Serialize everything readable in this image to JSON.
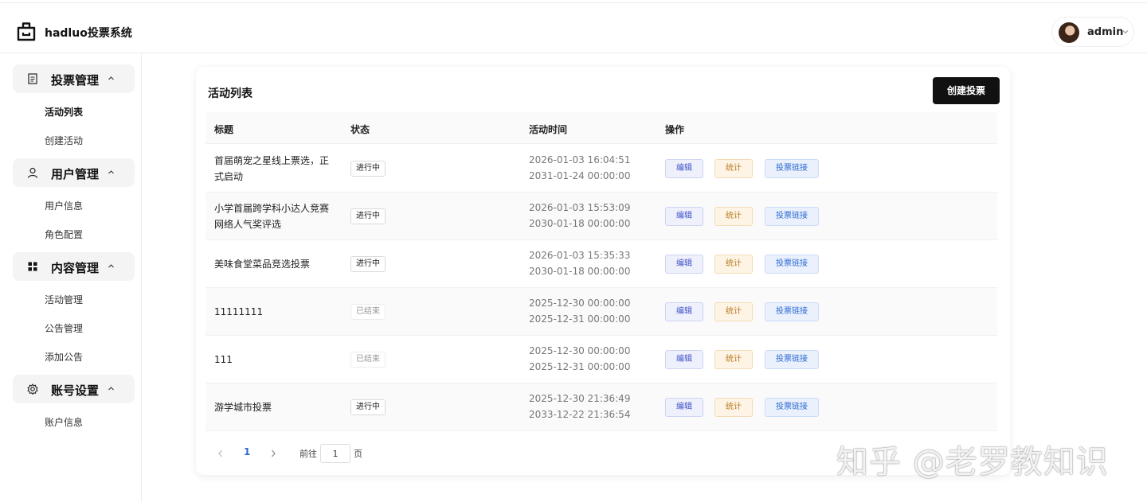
{
  "app": {
    "title": "hadluo投票系统",
    "logo_icon": "bag-icon"
  },
  "user": {
    "name": "admin",
    "avatar_icon": "avatar",
    "caret_icon": "chevron-down-icon"
  },
  "sidebar": {
    "groups": [
      {
        "label": "投票管理",
        "icon": "document-icon",
        "items": [
          "活动列表",
          "创建活动"
        ],
        "active": "活动列表"
      },
      {
        "label": "用户管理",
        "icon": "user-icon",
        "items": [
          "用户信息",
          "角色配置"
        ]
      },
      {
        "label": "内容管理",
        "icon": "grid-icon",
        "items": [
          "活动管理",
          "公告管理",
          "添加公告"
        ]
      },
      {
        "label": "账号设置",
        "icon": "gear-icon",
        "items": [
          "账户信息"
        ]
      }
    ]
  },
  "main": {
    "title": "活动列表",
    "create_button": "创建投票",
    "columns": [
      "标题",
      "状态",
      "活动时间",
      "操作"
    ],
    "actions": {
      "edit": "编辑",
      "stats": "统计",
      "link": "投票链接"
    },
    "rows": [
      {
        "title": "首届萌宠之星线上票选，正式启动",
        "status": "进行中",
        "start": "2026-01-03 16:04:51",
        "end": "2031-01-24 00:00:00"
      },
      {
        "title": "小学首届跨学科小达人竞赛网络人气奖评选",
        "status": "进行中",
        "start": "2026-01-03 15:53:09",
        "end": "2030-01-18 00:00:00"
      },
      {
        "title": "美味食堂菜品竞选投票",
        "status": "进行中",
        "start": "2026-01-03 15:35:33",
        "end": "2030-01-18 00:00:00"
      },
      {
        "title": "11111111",
        "status": "已结束",
        "start": "2025-12-30 00:00:00",
        "end": "2025-12-31 00:00:00"
      },
      {
        "title": "111",
        "status": "已结束",
        "start": "2025-12-30 00:00:00",
        "end": "2025-12-31 00:00:00"
      },
      {
        "title": "游学城市投票",
        "status": "进行中",
        "start": "2025-12-30 21:36:49",
        "end": "2033-12-22 21:36:54"
      }
    ],
    "pagination": {
      "current": "1",
      "goto_label": "前往",
      "goto_value": "1",
      "unit": "页"
    }
  },
  "watermark": "知乎 @老罗教知识"
}
